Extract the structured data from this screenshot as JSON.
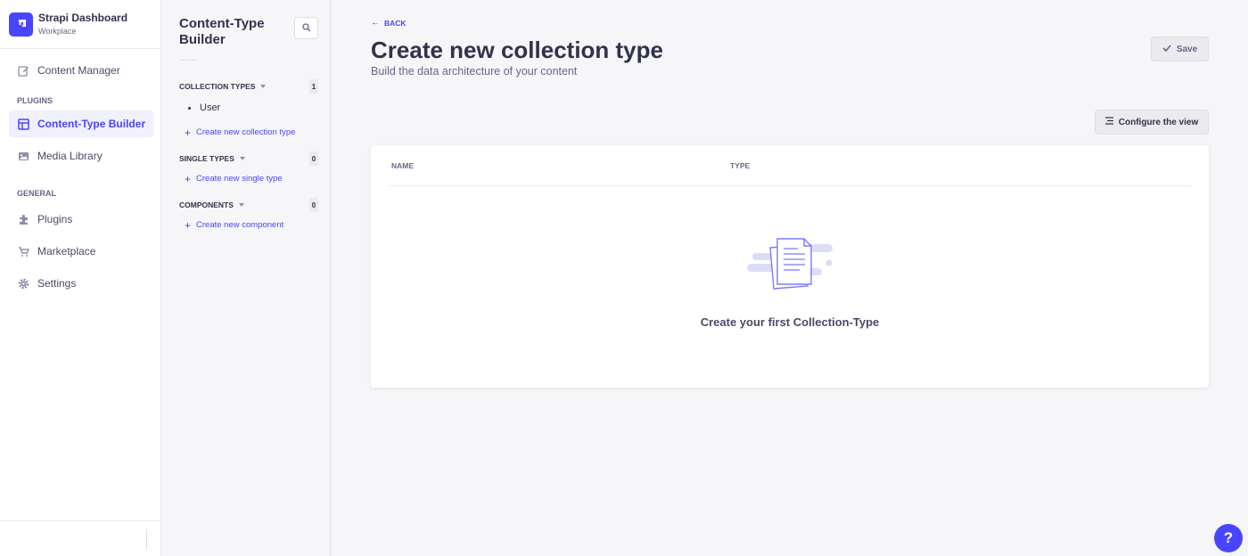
{
  "brand": {
    "title": "Strapi Dashboard",
    "subtitle": "Workplace"
  },
  "nav": {
    "content_manager": "Content Manager",
    "section_plugins": "PLUGINS",
    "content_type_builder": "Content-Type Builder",
    "media_library": "Media Library",
    "section_general": "GENERAL",
    "plugins": "Plugins",
    "marketplace": "Marketplace",
    "settings": "Settings"
  },
  "subnav": {
    "title": "Content-Type Builder",
    "collection_types": {
      "label": "COLLECTION TYPES",
      "count": "1",
      "items": [
        "User"
      ],
      "create": "Create new collection type"
    },
    "single_types": {
      "label": "SINGLE TYPES",
      "count": "0",
      "create": "Create new single type"
    },
    "components": {
      "label": "COMPONENTS",
      "count": "0",
      "create": "Create new component"
    }
  },
  "header": {
    "back": "BACK",
    "title": "Create new collection type",
    "subtitle": "Build the data architecture of your content",
    "save": "Save",
    "configure": "Configure the view"
  },
  "table": {
    "col_name": "NAME",
    "col_type": "TYPE",
    "empty": "Create your first Collection-Type"
  },
  "help": "?",
  "colors": {
    "primary": "#4945ff",
    "background": "#f6f6f9",
    "text": "#32324d"
  },
  "icons": [
    "pencil-square-icon",
    "layout-icon",
    "image-icon",
    "puzzle-icon",
    "cart-icon",
    "gear-icon",
    "search-icon",
    "check-icon",
    "lines-icon",
    "arrow-left-icon",
    "documents-illustration"
  ]
}
